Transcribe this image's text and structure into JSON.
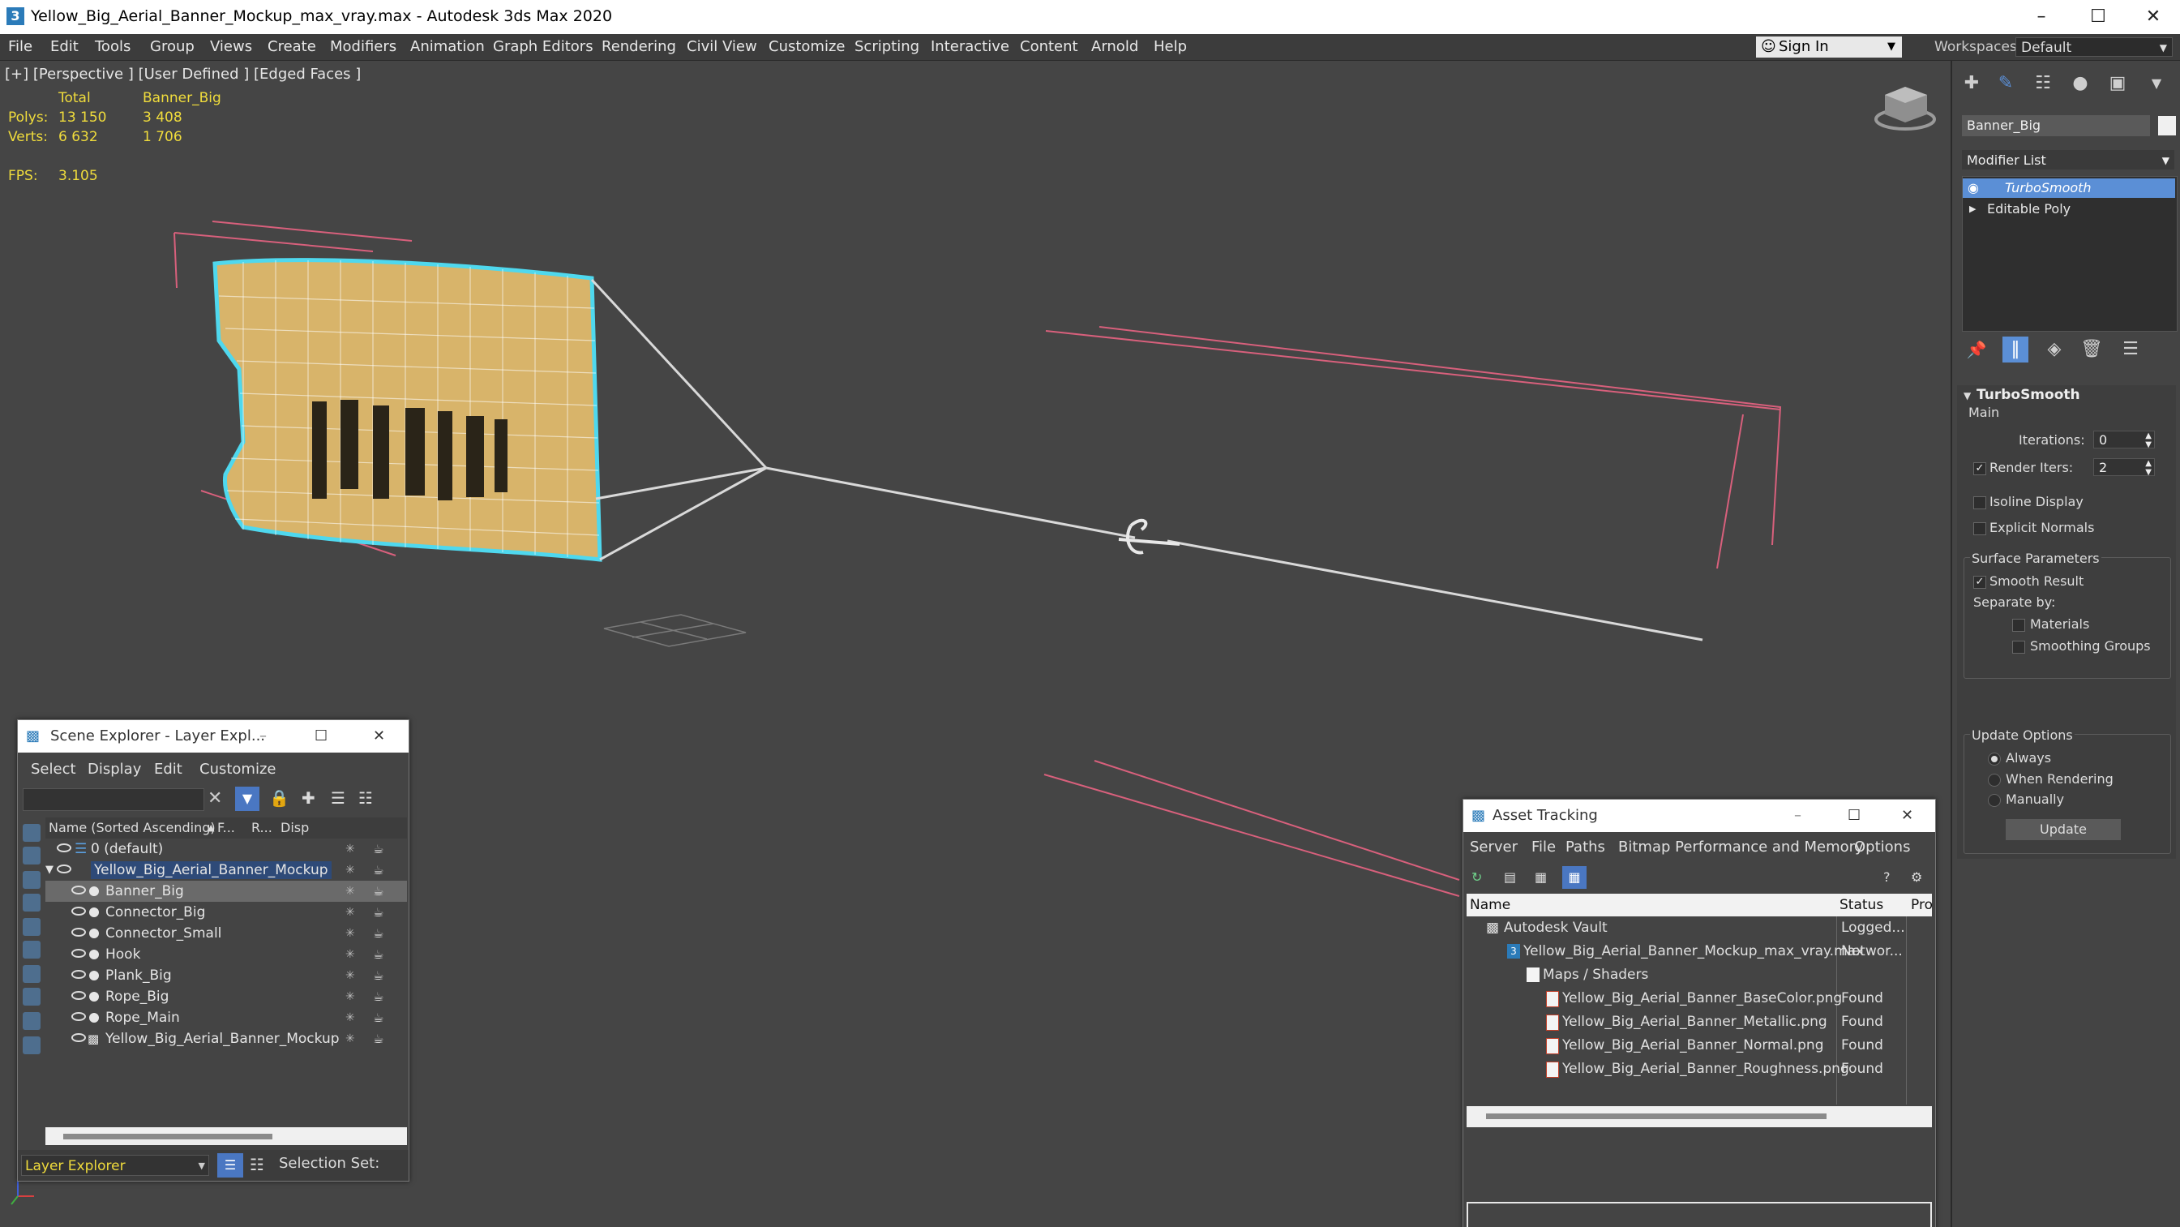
{
  "window": {
    "title": "Yellow_Big_Aerial_Banner_Mockup_max_vray.max - Autodesk 3ds Max 2020",
    "logo": "3"
  },
  "menu": [
    "File",
    "Edit",
    "Tools",
    "Group",
    "Views",
    "Create",
    "Modifiers",
    "Animation",
    "Graph Editors",
    "Rendering",
    "Civil View",
    "Customize",
    "Scripting",
    "Interactive",
    "Content",
    "Arnold",
    "Help"
  ],
  "account": {
    "sign_in": "Sign In",
    "workspaces_label": "Workspaces:",
    "workspace": "Default"
  },
  "viewport": {
    "label": "[+] [Perspective ] [User Defined ] [Edged Faces ]",
    "stats": {
      "col_total": "Total",
      "col_object": "Banner_Big",
      "polys_label": "Polys:",
      "polys_total": "13 150",
      "polys_obj": "3 408",
      "verts_label": "Verts:",
      "verts_total": "6 632",
      "verts_obj": "1 706",
      "fps_label": "FPS:",
      "fps": "3.105"
    }
  },
  "command_panel": {
    "object_name": "Banner_Big",
    "modifier_list": "Modifier List",
    "stack": [
      "TurboSmooth",
      "Editable Poly"
    ],
    "rollout": "TurboSmooth",
    "main": "Main",
    "iterations_label": "Iterations:",
    "iterations": "0",
    "render_iters_label": "Render Iters:",
    "render_iters": "2",
    "isoline": "Isoline Display",
    "explicit_normals": "Explicit Normals",
    "surface_params": "Surface Parameters",
    "smooth_result": "Smooth Result",
    "separate_by": "Separate by:",
    "materials": "Materials",
    "smoothing_groups": "Smoothing Groups",
    "update_options": "Update Options",
    "always": "Always",
    "when_rendering": "When Rendering",
    "manually": "Manually",
    "update_button": "Update"
  },
  "scene_explorer": {
    "title": "Scene Explorer - Layer Expl...",
    "menu": [
      "Select",
      "Display",
      "Edit",
      "Customize"
    ],
    "columns": {
      "name": "Name (Sorted Ascending)",
      "frozen": "F...",
      "renderable": "R...",
      "display": "Disp"
    },
    "rows": [
      {
        "name": "0 (default)",
        "level": 0
      },
      {
        "name": "Yellow_Big_Aerial_Banner_Mockup",
        "level": 0
      },
      {
        "name": "Banner_Big",
        "level": 1
      },
      {
        "name": "Connector_Big",
        "level": 1
      },
      {
        "name": "Connector_Small",
        "level": 1
      },
      {
        "name": "Hook",
        "level": 1
      },
      {
        "name": "Plank_Big",
        "level": 1
      },
      {
        "name": "Rope_Big",
        "level": 1
      },
      {
        "name": "Rope_Main",
        "level": 1
      },
      {
        "name": "Yellow_Big_Aerial_Banner_Mockup",
        "level": 1
      }
    ],
    "footer_dropdown": "Layer Explorer",
    "selection_set": "Selection Set:"
  },
  "asset_tracking": {
    "title": "Asset Tracking",
    "menu": [
      "Server",
      "File",
      "Paths",
      "Bitmap Performance and Memory",
      "Options"
    ],
    "columns": {
      "name": "Name",
      "status": "Status",
      "proxy": "Pro"
    },
    "rows": [
      {
        "name": "Autodesk Vault",
        "status": "Logged...",
        "indent": 0
      },
      {
        "name": "Yellow_Big_Aerial_Banner_Mockup_max_vray.max",
        "status": "Networ...",
        "indent": 1
      },
      {
        "name": "Maps / Shaders",
        "status": "",
        "indent": 2
      },
      {
        "name": "Yellow_Big_Aerial_Banner_BaseColor.png",
        "status": "Found",
        "indent": 3
      },
      {
        "name": "Yellow_Big_Aerial_Banner_Metallic.png",
        "status": "Found",
        "indent": 3
      },
      {
        "name": "Yellow_Big_Aerial_Banner_Normal.png",
        "status": "Found",
        "indent": 3
      },
      {
        "name": "Yellow_Big_Aerial_Banner_Roughness.png",
        "status": "Found",
        "indent": 3
      }
    ]
  },
  "colors": {
    "accent": "#5b8fd6",
    "selection": "#4a77c2",
    "stats_yellow": "#f0dc3c",
    "banner_yellow": "#d8b46a",
    "highlight_cyan": "#4fd8ee"
  }
}
